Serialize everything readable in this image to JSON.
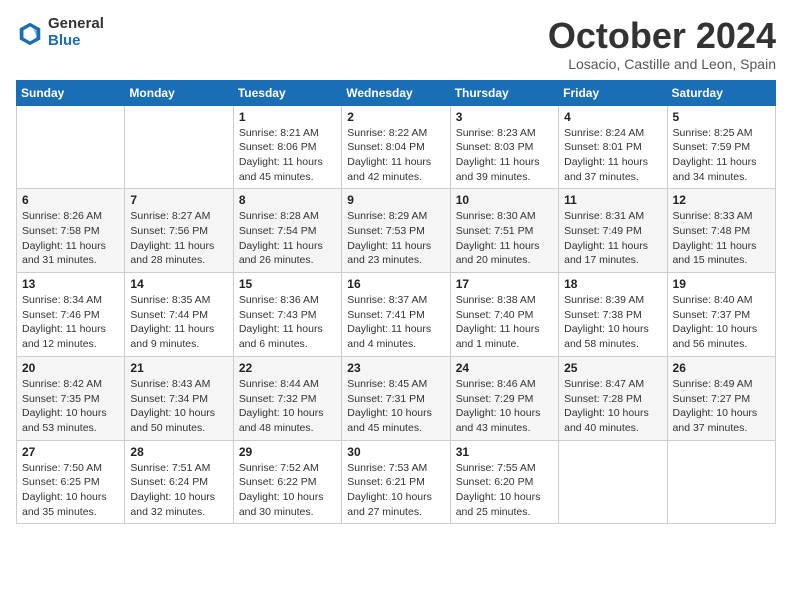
{
  "logo": {
    "general": "General",
    "blue": "Blue"
  },
  "title": "October 2024",
  "location": "Losacio, Castille and Leon, Spain",
  "days_header": [
    "Sunday",
    "Monday",
    "Tuesday",
    "Wednesday",
    "Thursday",
    "Friday",
    "Saturday"
  ],
  "weeks": [
    [
      {
        "day": "",
        "info": ""
      },
      {
        "day": "",
        "info": ""
      },
      {
        "day": "1",
        "info": "Sunrise: 8:21 AM\nSunset: 8:06 PM\nDaylight: 11 hours and 45 minutes."
      },
      {
        "day": "2",
        "info": "Sunrise: 8:22 AM\nSunset: 8:04 PM\nDaylight: 11 hours and 42 minutes."
      },
      {
        "day": "3",
        "info": "Sunrise: 8:23 AM\nSunset: 8:03 PM\nDaylight: 11 hours and 39 minutes."
      },
      {
        "day": "4",
        "info": "Sunrise: 8:24 AM\nSunset: 8:01 PM\nDaylight: 11 hours and 37 minutes."
      },
      {
        "day": "5",
        "info": "Sunrise: 8:25 AM\nSunset: 7:59 PM\nDaylight: 11 hours and 34 minutes."
      }
    ],
    [
      {
        "day": "6",
        "info": "Sunrise: 8:26 AM\nSunset: 7:58 PM\nDaylight: 11 hours and 31 minutes."
      },
      {
        "day": "7",
        "info": "Sunrise: 8:27 AM\nSunset: 7:56 PM\nDaylight: 11 hours and 28 minutes."
      },
      {
        "day": "8",
        "info": "Sunrise: 8:28 AM\nSunset: 7:54 PM\nDaylight: 11 hours and 26 minutes."
      },
      {
        "day": "9",
        "info": "Sunrise: 8:29 AM\nSunset: 7:53 PM\nDaylight: 11 hours and 23 minutes."
      },
      {
        "day": "10",
        "info": "Sunrise: 8:30 AM\nSunset: 7:51 PM\nDaylight: 11 hours and 20 minutes."
      },
      {
        "day": "11",
        "info": "Sunrise: 8:31 AM\nSunset: 7:49 PM\nDaylight: 11 hours and 17 minutes."
      },
      {
        "day": "12",
        "info": "Sunrise: 8:33 AM\nSunset: 7:48 PM\nDaylight: 11 hours and 15 minutes."
      }
    ],
    [
      {
        "day": "13",
        "info": "Sunrise: 8:34 AM\nSunset: 7:46 PM\nDaylight: 11 hours and 12 minutes."
      },
      {
        "day": "14",
        "info": "Sunrise: 8:35 AM\nSunset: 7:44 PM\nDaylight: 11 hours and 9 minutes."
      },
      {
        "day": "15",
        "info": "Sunrise: 8:36 AM\nSunset: 7:43 PM\nDaylight: 11 hours and 6 minutes."
      },
      {
        "day": "16",
        "info": "Sunrise: 8:37 AM\nSunset: 7:41 PM\nDaylight: 11 hours and 4 minutes."
      },
      {
        "day": "17",
        "info": "Sunrise: 8:38 AM\nSunset: 7:40 PM\nDaylight: 11 hours and 1 minute."
      },
      {
        "day": "18",
        "info": "Sunrise: 8:39 AM\nSunset: 7:38 PM\nDaylight: 10 hours and 58 minutes."
      },
      {
        "day": "19",
        "info": "Sunrise: 8:40 AM\nSunset: 7:37 PM\nDaylight: 10 hours and 56 minutes."
      }
    ],
    [
      {
        "day": "20",
        "info": "Sunrise: 8:42 AM\nSunset: 7:35 PM\nDaylight: 10 hours and 53 minutes."
      },
      {
        "day": "21",
        "info": "Sunrise: 8:43 AM\nSunset: 7:34 PM\nDaylight: 10 hours and 50 minutes."
      },
      {
        "day": "22",
        "info": "Sunrise: 8:44 AM\nSunset: 7:32 PM\nDaylight: 10 hours and 48 minutes."
      },
      {
        "day": "23",
        "info": "Sunrise: 8:45 AM\nSunset: 7:31 PM\nDaylight: 10 hours and 45 minutes."
      },
      {
        "day": "24",
        "info": "Sunrise: 8:46 AM\nSunset: 7:29 PM\nDaylight: 10 hours and 43 minutes."
      },
      {
        "day": "25",
        "info": "Sunrise: 8:47 AM\nSunset: 7:28 PM\nDaylight: 10 hours and 40 minutes."
      },
      {
        "day": "26",
        "info": "Sunrise: 8:49 AM\nSunset: 7:27 PM\nDaylight: 10 hours and 37 minutes."
      }
    ],
    [
      {
        "day": "27",
        "info": "Sunrise: 7:50 AM\nSunset: 6:25 PM\nDaylight: 10 hours and 35 minutes."
      },
      {
        "day": "28",
        "info": "Sunrise: 7:51 AM\nSunset: 6:24 PM\nDaylight: 10 hours and 32 minutes."
      },
      {
        "day": "29",
        "info": "Sunrise: 7:52 AM\nSunset: 6:22 PM\nDaylight: 10 hours and 30 minutes."
      },
      {
        "day": "30",
        "info": "Sunrise: 7:53 AM\nSunset: 6:21 PM\nDaylight: 10 hours and 27 minutes."
      },
      {
        "day": "31",
        "info": "Sunrise: 7:55 AM\nSunset: 6:20 PM\nDaylight: 10 hours and 25 minutes."
      },
      {
        "day": "",
        "info": ""
      },
      {
        "day": "",
        "info": ""
      }
    ]
  ]
}
